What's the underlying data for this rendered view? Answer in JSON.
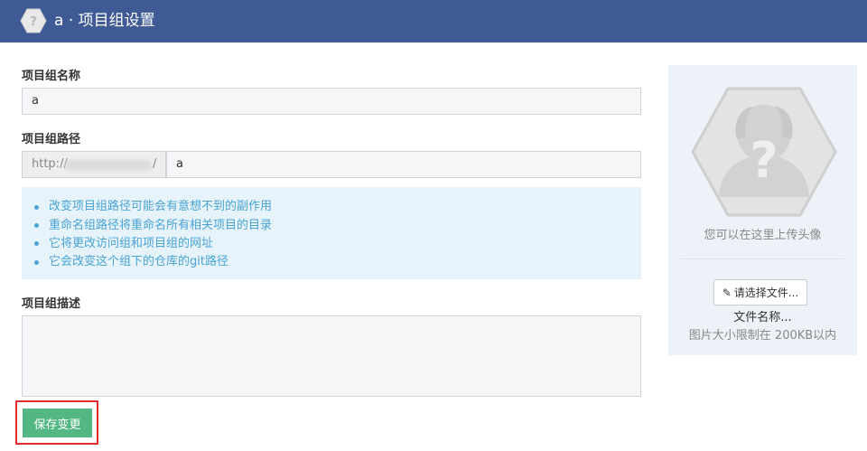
{
  "header": {
    "title": "a · 项目组设置",
    "logo_icon": "hexagon-avatar-placeholder-icon",
    "bg_color": "#3f5a94"
  },
  "form": {
    "name_label": "项目组名称",
    "name_value": "a",
    "path_label": "项目组路径",
    "path_prefix": "http://",
    "path_prefix_suffix": "/",
    "path_value": "a",
    "notices": [
      "改变项目组路径可能会有意想不到的副作用",
      "重命名组路径将重命名所有相关项目的目录",
      "它将更改访问组和项目组的网址",
      "它会改变这个组下的仓库的git路径"
    ],
    "description_label": "项目组描述",
    "description_value": "",
    "save_label": "保存变更"
  },
  "sidebar": {
    "upload_tip": "您可以在这里上传头像",
    "choose_file_label": "请选择文件...",
    "file_name": "文件名称...",
    "size_tip": "图片大小限制在 200KB以内"
  },
  "colors": {
    "accent_green": "#52b783",
    "notice_text": "#4aa3d3",
    "highlight_red": "#e02d2d"
  }
}
